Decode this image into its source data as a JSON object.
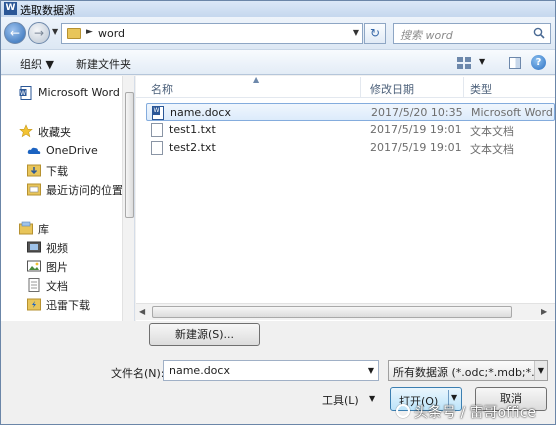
{
  "window": {
    "title": "选取数据源",
    "app_icon": "word-icon"
  },
  "nav": {
    "address_path": "word",
    "search_placeholder": "搜索 word"
  },
  "toolbar": {
    "organize": "组织 ▼",
    "new_folder": "新建文件夹"
  },
  "sidebar": {
    "items": [
      {
        "label": "Microsoft Word",
        "icon": "word-doc-icon",
        "top": true
      },
      {
        "label": "收藏夹",
        "icon": "star-icon",
        "top": true
      },
      {
        "label": "OneDrive",
        "icon": "cloud-icon"
      },
      {
        "label": "下载",
        "icon": "download-folder-icon"
      },
      {
        "label": "最近访问的位置",
        "icon": "recent-places-icon"
      },
      {
        "label": "库",
        "icon": "library-icon",
        "top": true
      },
      {
        "label": "视频",
        "icon": "video-icon"
      },
      {
        "label": "图片",
        "icon": "picture-icon"
      },
      {
        "label": "文档",
        "icon": "document-icon"
      },
      {
        "label": "迅雷下载",
        "icon": "thunder-download-icon"
      }
    ]
  },
  "columns": {
    "name": "名称",
    "date": "修改日期",
    "type": "类型"
  },
  "files": [
    {
      "name": "name.docx",
      "date": "2017/5/20 10:35",
      "type": "Microsoft Word ...",
      "selected": true
    },
    {
      "name": "test1.txt",
      "date": "2017/5/19 19:01",
      "type": "文本文档",
      "selected": false
    },
    {
      "name": "test2.txt",
      "date": "2017/5/19 19:01",
      "type": "文本文档",
      "selected": false
    }
  ],
  "new_source_button": "新建源(S)...",
  "filename": {
    "label": "文件名(N):",
    "value": "name.docx"
  },
  "filter": {
    "value": "所有数据源 (*.odc;*.mdb;*.md"
  },
  "tools": {
    "label": "工具(L)"
  },
  "open_button": "打开(O)",
  "cancel_button": "取消",
  "watermark": "头条号 / 雷哥office",
  "colors": {
    "accent": "#2b5797",
    "selection": "#dcebfb",
    "toolbar": "#e3ecf6"
  }
}
